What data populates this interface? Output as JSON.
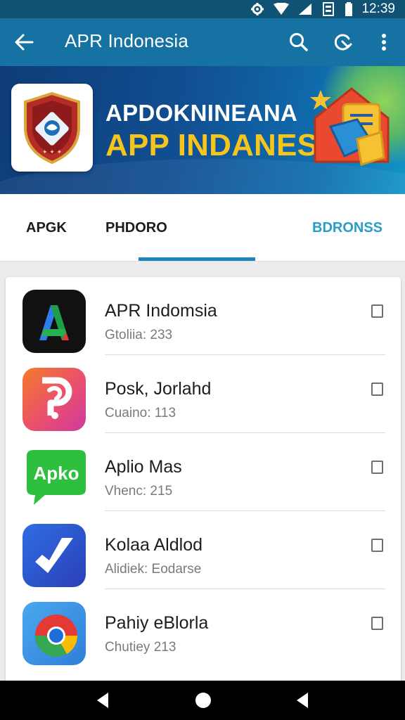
{
  "status_bar": {
    "time": "12:39"
  },
  "app_bar": {
    "title": "APR Indonesia",
    "back_icon": "arrow-back-icon",
    "actions": [
      "search-icon",
      "refresh-search-icon",
      "more-vert-icon"
    ]
  },
  "banner": {
    "headline_top": "APDOKNINEANA",
    "headline_bottom": "APP INDANESIA",
    "logo_icon": "shield-emblem-icon",
    "art_icon": "house-folder-illustration"
  },
  "tabs": [
    {
      "label": "APGK",
      "active": false
    },
    {
      "label": "PHDORO",
      "active": false
    },
    {
      "label": "BDRONSS",
      "active": true
    }
  ],
  "apps": [
    {
      "name": "APR Indomsia",
      "sub": "Gtoliia: 233",
      "icon": "letter-a-app-icon"
    },
    {
      "name": "Posk, Jorlahd",
      "sub": "Cuaino: 113",
      "icon": "p-question-app-icon"
    },
    {
      "name": "Aplio Mas",
      "sub": "Vhenc: 215",
      "icon": "apko-chat-app-icon",
      "icon_text": "Apko"
    },
    {
      "name": "Kolaa Aldlod",
      "sub": "Alidiek: Eodarse",
      "icon": "check-swoosh-app-icon"
    },
    {
      "name": "Pahiy eBlorla",
      "sub": "Chutiey 213",
      "icon": "chrome-like-app-icon"
    }
  ],
  "colors": {
    "status_bar": "#0f5274",
    "app_bar": "#1572a3",
    "tab_active": "#2a9dc7",
    "tab_indicator": "#1a87bd",
    "banner_headline_bottom": "#f5c51b"
  }
}
